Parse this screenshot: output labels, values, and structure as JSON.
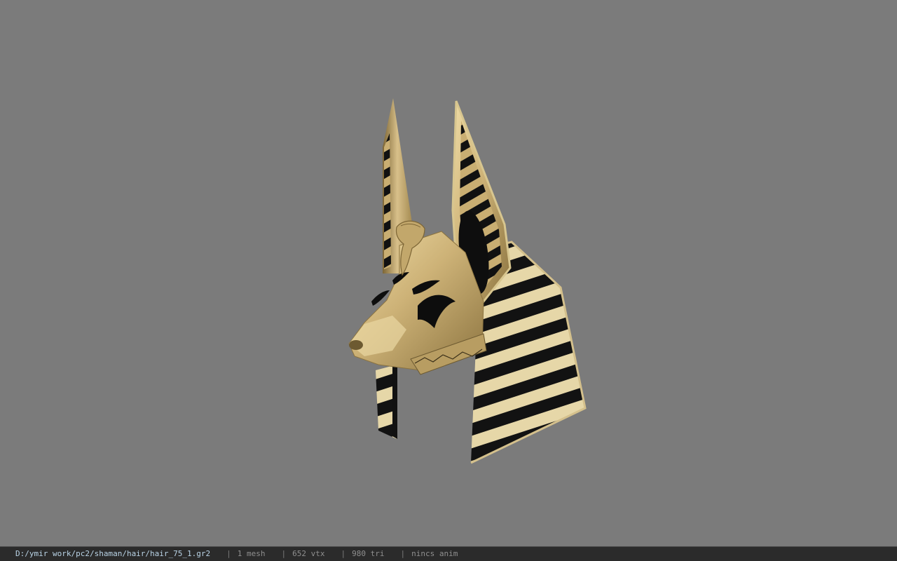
{
  "viewer": {
    "background_color": "#7b7b7b",
    "model_name": "Anubis jackal headpiece"
  },
  "status_bar": {
    "file_path": "D:/ymir work/pc2/shaman/hair/hair_75_1.gr2",
    "separator": "|",
    "mesh_count": "1 mesh",
    "vertex_count": "652 vtx",
    "triangle_count": "980 tri",
    "anim_info": "nincs anim"
  },
  "colors": {
    "gold": "#c9ae72",
    "gold_light": "#e3cf98",
    "gold_dark": "#8c7440",
    "stripe_black": "#111111",
    "stripe_cream": "#e8dcb4"
  }
}
